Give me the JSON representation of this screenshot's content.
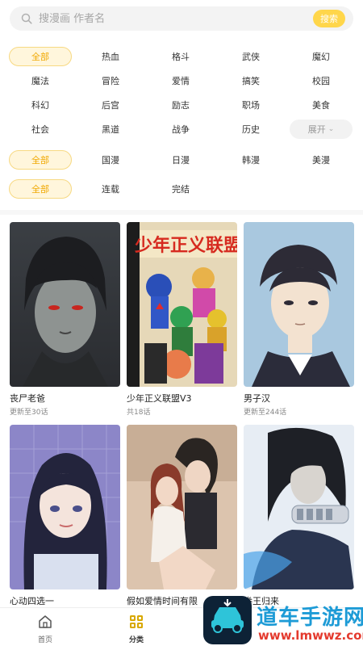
{
  "search": {
    "placeholder": "搜漫画 作者名",
    "button_label": "搜索"
  },
  "filters": {
    "genres": [
      [
        "全部",
        "热血",
        "格斗",
        "武侠",
        "魔幻"
      ],
      [
        "魔法",
        "冒险",
        "爱情",
        "搞笑",
        "校园"
      ],
      [
        "科幻",
        "后宫",
        "励志",
        "职场",
        "美食"
      ],
      [
        "社会",
        "黑道",
        "战争",
        "历史"
      ]
    ],
    "expand_label": "展开",
    "regions": [
      "全部",
      "国漫",
      "日漫",
      "韩漫",
      "美漫"
    ],
    "status": [
      "全部",
      "连载",
      "完结"
    ]
  },
  "comics": [
    {
      "title": "丧尸老爸",
      "sub": "更新至30话"
    },
    {
      "title": "少年正义联盟V3",
      "sub": "共18话",
      "cover_text": "少年正义联盟"
    },
    {
      "title": "男子汉",
      "sub": "更新至244话"
    },
    {
      "title": "心动四选一",
      "sub": ""
    },
    {
      "title": "假如爱情时间有限",
      "sub": ""
    },
    {
      "title": "拳王归来",
      "sub": ""
    }
  ],
  "nav": [
    {
      "label": "首页",
      "icon": "home-icon"
    },
    {
      "label": "分类",
      "icon": "grid-icon"
    }
  ],
  "watermark": {
    "line1": "道车手游网",
    "line2": "www.lmwwz.com"
  },
  "colors": {
    "accent": "#ffd64a",
    "active_text": "#f0a800",
    "active_bg": "#fff6dc"
  }
}
